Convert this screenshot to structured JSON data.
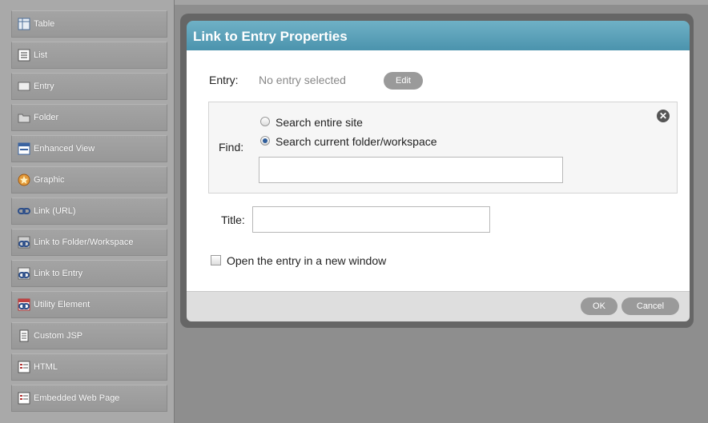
{
  "palette": {
    "items": [
      {
        "label": "Table",
        "icon": "table-icon"
      },
      {
        "label": "List",
        "icon": "list-icon"
      },
      {
        "label": "Entry",
        "icon": "entry-icon"
      },
      {
        "label": "Folder",
        "icon": "folder-icon"
      },
      {
        "label": "Enhanced View",
        "icon": "enhanced-view-icon"
      },
      {
        "label": "Graphic",
        "icon": "graphic-icon"
      },
      {
        "label": "Link (URL)",
        "icon": "link-icon"
      },
      {
        "label": "Link to Folder/Workspace",
        "icon": "link-folder-icon"
      },
      {
        "label": "Link to Entry",
        "icon": "link-entry-icon"
      },
      {
        "label": "Utility Element",
        "icon": "utility-icon"
      },
      {
        "label": "Custom JSP",
        "icon": "jsp-icon"
      },
      {
        "label": "HTML",
        "icon": "html-icon"
      },
      {
        "label": "Embedded Web Page",
        "icon": "embedded-page-icon"
      }
    ]
  },
  "dialog": {
    "title": "Link to Entry Properties",
    "entry_label": "Entry:",
    "entry_value": "No entry selected",
    "edit_button": "Edit",
    "find_label": "Find:",
    "find_options": [
      "Search entire site",
      "Search current folder/workspace"
    ],
    "find_selected": 1,
    "find_input_value": "",
    "title_label": "Title:",
    "title_input_value": "",
    "new_window_label": "Open the entry in a new window",
    "new_window_checked": false,
    "ok_button": "OK",
    "cancel_button": "Cancel"
  },
  "colors": {
    "title_bar": "#5aa2bb",
    "button_gray": "#9a9a9a"
  }
}
